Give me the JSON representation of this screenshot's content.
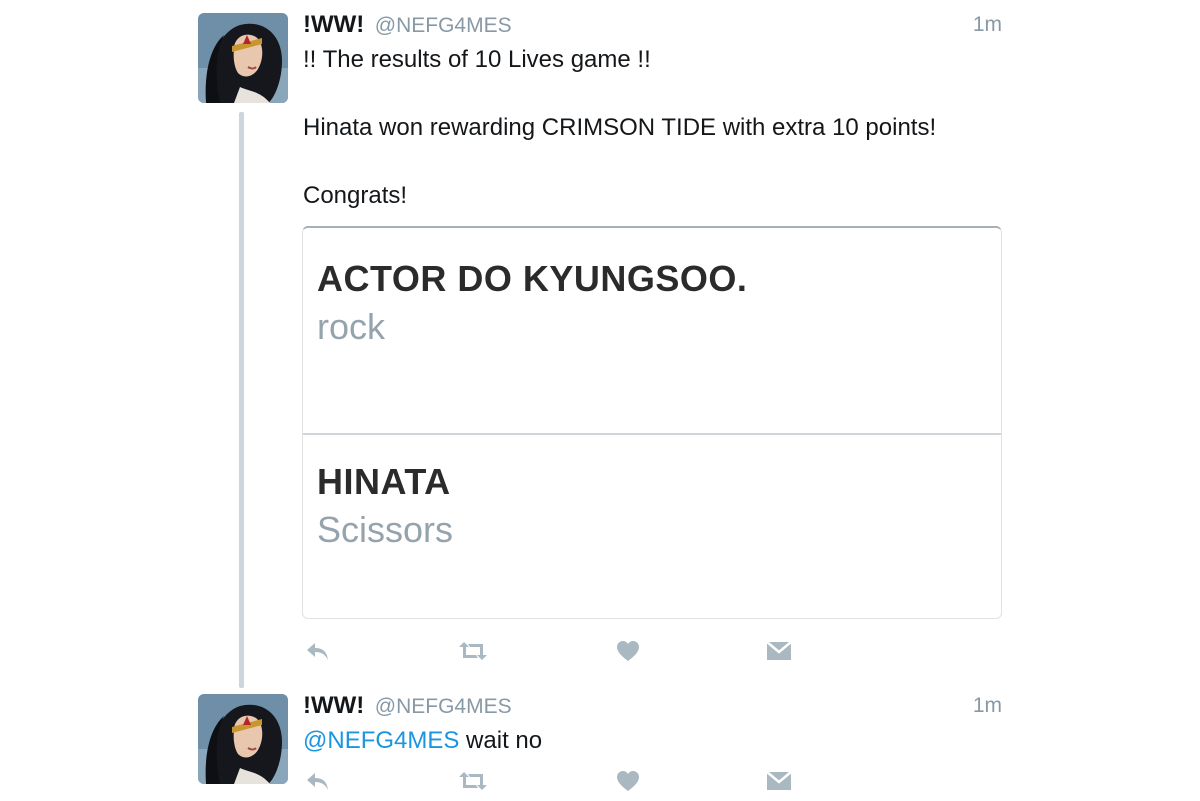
{
  "tweets": [
    {
      "author": {
        "name": "!WW!",
        "handle": "@NEFG4MES"
      },
      "time": "1m",
      "lines": [
        "!! The results of 10 Lives game !!",
        "Hinata won rewarding CRIMSON TIDE with extra 10 points!",
        "Congrats!"
      ],
      "card": {
        "options": [
          {
            "title": "ACTOR DO KYUNGSOO.",
            "subtitle": "rock"
          },
          {
            "title": "HINATA",
            "subtitle": "Scissors"
          }
        ]
      },
      "actions": [
        "reply-icon",
        "retweet-icon",
        "like-icon",
        "direct-message-icon"
      ]
    },
    {
      "author": {
        "name": "!WW!",
        "handle": "@NEFG4MES"
      },
      "time": "1m",
      "mention": "@NEFG4MES",
      "text": " wait no",
      "actions": [
        "reply-icon",
        "retweet-icon",
        "like-icon",
        "direct-message-icon"
      ]
    }
  ],
  "colors": {
    "text": "#14171a",
    "secondary": "#8899a6",
    "link": "#1b95e0",
    "thread_line": "#ccd6dd"
  }
}
